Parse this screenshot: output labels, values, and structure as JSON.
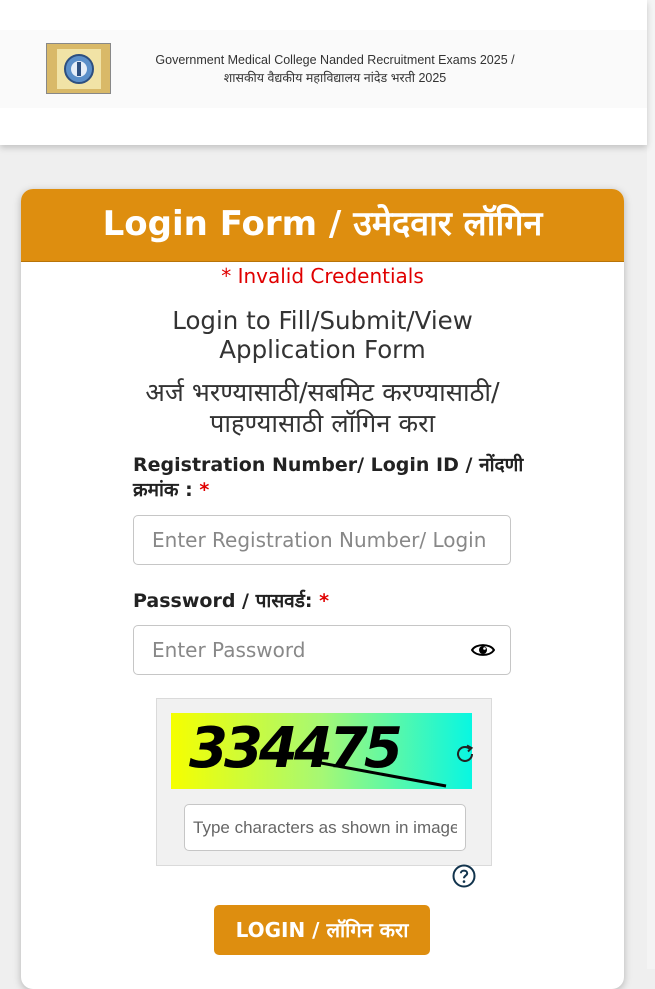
{
  "header": {
    "line1": "Government Medical College Nanded Recruitment Exams 2025 /",
    "line2": "शासकीय वैद्यकीय महाविद्यालय नांदेड भरती 2025"
  },
  "card": {
    "title": "Login Form / उमेदवार लॉगिन",
    "error": "* Invalid Credentials",
    "instruction_en": "Login to Fill/Submit/View Application Form",
    "instruction_mr": "अर्ज भरण्यासाठी/सबमिट करण्यासाठी/ पाहण्यासाठी लॉगिन करा"
  },
  "form": {
    "registration_label": "Registration Number/ Login ID / नोंदणी क्रमांक :",
    "registration_placeholder": "Enter Registration Number/ Login ID",
    "password_label": "Password / पासवर्ड:",
    "password_placeholder": "Enter Password",
    "required_mark": "*"
  },
  "captcha": {
    "code": "334475",
    "placeholder": "Type characters as shown in image"
  },
  "login_button": "LOGIN / लॉगिन करा",
  "colors": {
    "accent": "#de8e0f",
    "error": "#e00000"
  },
  "icons": {
    "eye": "eye-icon",
    "refresh": "refresh-icon",
    "help": "help-icon"
  }
}
